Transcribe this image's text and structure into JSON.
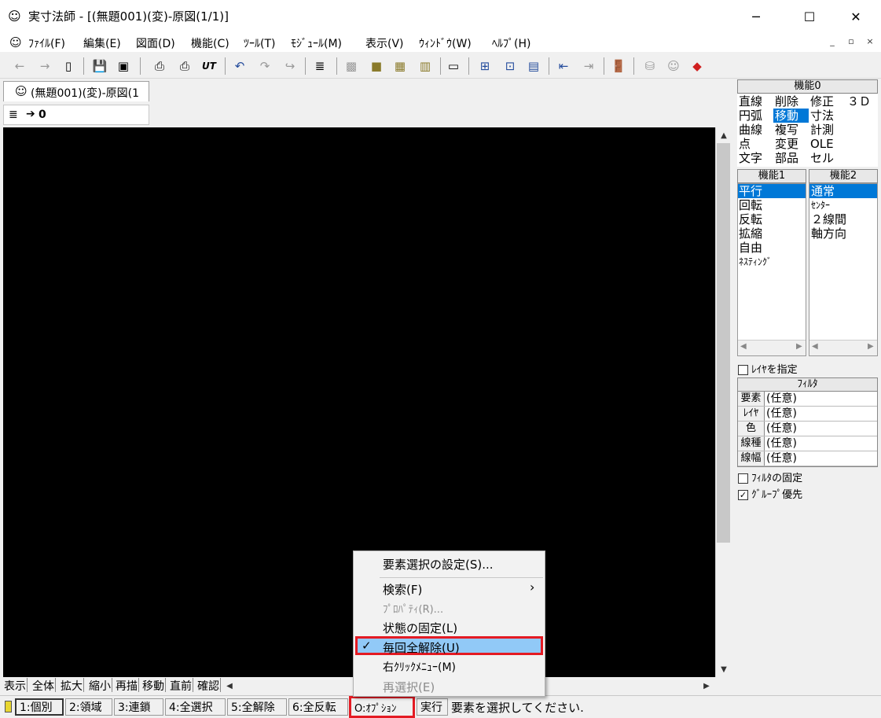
{
  "window": {
    "title": "実寸法師 - [(無題001)(変)-原図(1/1)]",
    "minimize": "─",
    "maximize": "☐",
    "close": "✕"
  },
  "menu": [
    "ﾌｧｲﾙ(F)",
    "編集(E)",
    "図面(D)",
    "機能(C)",
    "ﾂｰﾙ(T)",
    "ﾓｼﾞｭｰﾙ(M)",
    "表示(V)",
    "ｳｨﾝﾄﾞｳ(W)",
    "ﾍﾙﾌﾟ(H)"
  ],
  "mdi_controls": [
    "_",
    "▫",
    "×"
  ],
  "document_tab": "(無題001)(変)-原図(1",
  "layer_bar": "0",
  "command_row": [
    "表示",
    "全体",
    "拡大",
    "縮小",
    "再描",
    "移動",
    "直前",
    "確認"
  ],
  "status_buttons": [
    "1:個別",
    "2:領域",
    "3:連鎖",
    "4:全選択",
    "5:全解除",
    "6:全反転",
    "O:ｵﾌﾟｼｮﾝ",
    "実行"
  ],
  "status_message": "要素を選択してください.",
  "panel": {
    "func0_header": "機能0",
    "func0": [
      [
        "直線",
        "削除",
        "修正",
        "３Ｄ"
      ],
      [
        "円弧",
        "移動",
        "寸法",
        ""
      ],
      [
        "曲線",
        "複写",
        "計測",
        ""
      ],
      [
        "点",
        "変更",
        "OLE",
        ""
      ],
      [
        "文字",
        "部品",
        "セル",
        ""
      ]
    ],
    "func1_header": "機能1",
    "func1": [
      "平行",
      "回転",
      "反転",
      "拡縮",
      "自由",
      "ﾈｽﾃｨﾝｸﾞ"
    ],
    "func2_header": "機能2",
    "func2": [
      "通常",
      "ｾﾝﾀｰ",
      "２線間",
      "軸方向"
    ],
    "layer_check": "ﾚｲﾔを指定",
    "filter_header": "ﾌｨﾙﾀ",
    "filter_rows": [
      {
        "key": "要素",
        "val": "(任意)"
      },
      {
        "key": "ﾚｲﾔ",
        "val": "(任意)"
      },
      {
        "key": "色",
        "val": "(任意)"
      },
      {
        "key": "線種",
        "val": "(任意)"
      },
      {
        "key": "線幅",
        "val": "(任意)"
      }
    ],
    "filter_fix": "ﾌｨﾙﾀの固定",
    "group_priority": "ｸﾞﾙｰﾌﾟ優先",
    "group_priority_checked": true
  },
  "context_menu": {
    "items": [
      {
        "label": "要素選択の設定(S)...",
        "disabled": false
      },
      {
        "label": "検索(F)",
        "disabled": false,
        "submenu": true
      },
      {
        "label": "ﾌﾟﾛﾊﾟﾃｨ(R)...",
        "disabled": true
      },
      {
        "label": "状態の固定(L)",
        "disabled": false
      },
      {
        "label": "毎回全解除(U)",
        "disabled": false,
        "checked": true
      },
      {
        "label": "右ｸﾘｯｸﾒﾆｭｰ(M)",
        "disabled": false
      },
      {
        "label": "再選択(E)",
        "disabled": true
      }
    ],
    "submenu_arrow": "›",
    "check_mark": "✓"
  },
  "colors": {
    "highlight": "#0078d7",
    "menu_hover": "#91c9f7",
    "annotation_red": "#e41b23",
    "canvas": "#000000"
  }
}
